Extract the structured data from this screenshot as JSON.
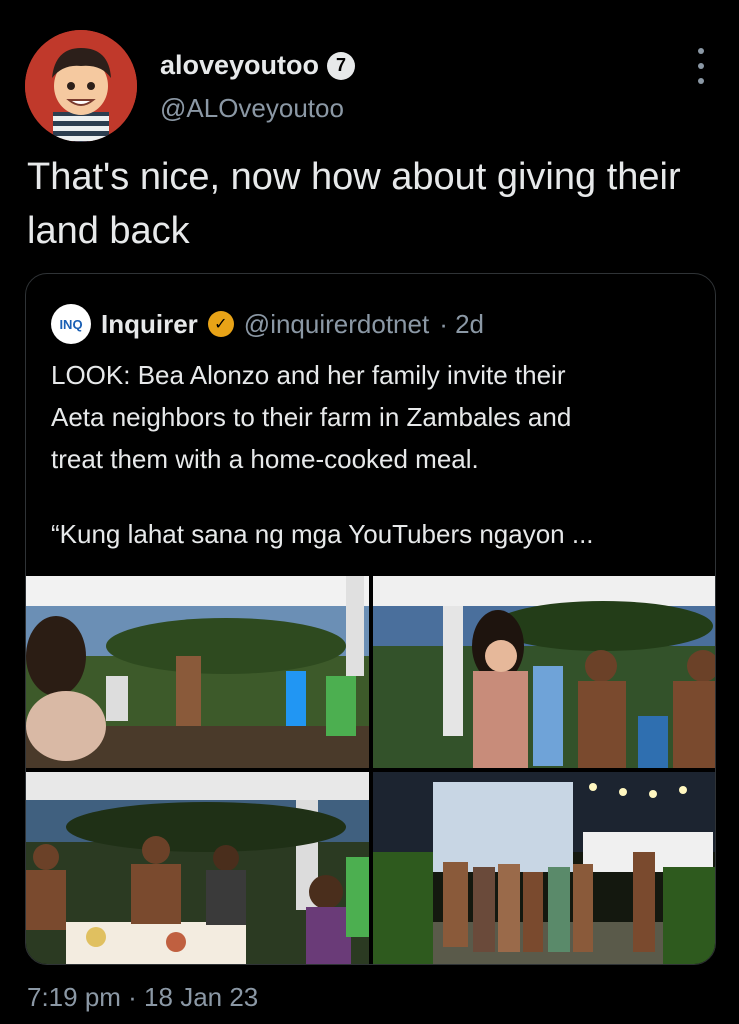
{
  "author": {
    "display_name": "aloveyoutoo",
    "badge_text": "7",
    "handle": "@ALOveyoutoo",
    "avatar_icon": "cartoon-avatar-icon"
  },
  "tweet": {
    "text": "That's nice, now how about giving their land back",
    "timestamp": "7:19 pm · 18 Jan 23"
  },
  "quoted": {
    "logo_text": "INQ",
    "name": "Inquirer",
    "handle": "@inquirerdotnet",
    "age": "· 2d",
    "text": "LOOK: Bea Alonzo and her family invite their\nAeta neighbors to their farm in Zambales and\ntreat them with a home-cooked meal.",
    "quote_line": "“Kung lahat sana ng mga YouTubers ngayon ...",
    "verified_color": "#e8a317"
  },
  "colors": {
    "background": "#000000",
    "text": "#e7e9ea",
    "muted": "#8b98a5",
    "border": "#2f3336"
  }
}
